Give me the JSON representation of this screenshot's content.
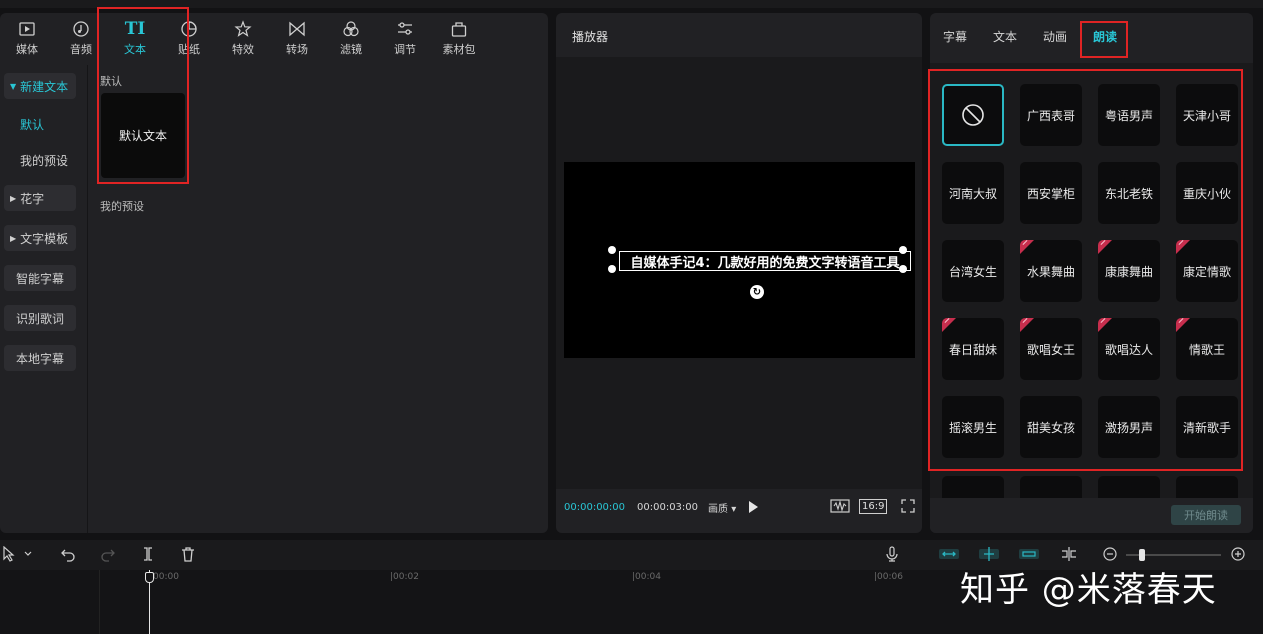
{
  "toolbar": {
    "items": [
      {
        "label": "媒体",
        "icon": "media-icon"
      },
      {
        "label": "音频",
        "icon": "audio-icon"
      },
      {
        "label": "文本",
        "icon": "text-icon",
        "active": true
      },
      {
        "label": "贴纸",
        "icon": "sticker-icon"
      },
      {
        "label": "特效",
        "icon": "effects-icon"
      },
      {
        "label": "转场",
        "icon": "transition-icon"
      },
      {
        "label": "滤镜",
        "icon": "filter-icon"
      },
      {
        "label": "调节",
        "icon": "adjust-icon"
      },
      {
        "label": "素材包",
        "icon": "asset-pack-icon"
      }
    ]
  },
  "sidebar": {
    "new_text": "新建文本",
    "default": "默认",
    "my_presets": "我的预设",
    "fancy_text": "花字",
    "text_templates": "文字模板",
    "smart_captions": "智能字幕",
    "recognize_lyrics": "识别歌词",
    "local_captions": "本地字幕"
  },
  "content": {
    "default_section": "默认",
    "default_card": "默认文本",
    "my_presets_section": "我的预设"
  },
  "player": {
    "title": "播放器",
    "caption_text": "自媒体手记4：几款好用的免费文字转语音工具",
    "time_current": "00:00:00:00",
    "time_total": "00:00:03:00",
    "quality": "画质",
    "aspect_ratio": "16:9"
  },
  "right_panel": {
    "tabs": [
      "字幕",
      "文本",
      "动画",
      "朗读"
    ],
    "active_tab": "朗读",
    "voices": [
      {
        "label": "",
        "type": "none",
        "selected": true
      },
      {
        "label": "广西表哥"
      },
      {
        "label": "粤语男声"
      },
      {
        "label": "天津小哥"
      },
      {
        "label": "河南大叔"
      },
      {
        "label": "西安掌柜"
      },
      {
        "label": "东北老铁"
      },
      {
        "label": "重庆小伙"
      },
      {
        "label": "台湾女生"
      },
      {
        "label": "水果舞曲",
        "badge": true
      },
      {
        "label": "康康舞曲",
        "badge": true
      },
      {
        "label": "康定情歌",
        "badge": true
      },
      {
        "label": "春日甜妹",
        "badge": true
      },
      {
        "label": "歌唱女王",
        "badge": true
      },
      {
        "label": "歌唱达人",
        "badge": true
      },
      {
        "label": "情歌王",
        "badge": true
      },
      {
        "label": "摇滚男生"
      },
      {
        "label": "甜美女孩"
      },
      {
        "label": "激扬男声"
      },
      {
        "label": "清新歌手"
      }
    ],
    "start_button": "开始朗读"
  },
  "timeline": {
    "ticks": [
      "00:00",
      "|00:02",
      "|00:04",
      "|00:06"
    ]
  },
  "watermark": "知乎 @米落春天",
  "colors": {
    "accent": "#29c6d5",
    "highlight": "#e02424",
    "badge": "#c72e4d"
  }
}
